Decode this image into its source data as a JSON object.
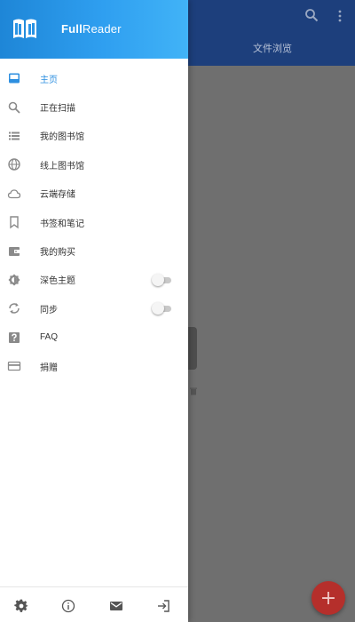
{
  "app": {
    "title_bold": "Full",
    "title_rest": "Reader"
  },
  "background": {
    "tab_label": "文件浏览"
  },
  "menu": {
    "items": [
      {
        "label": "主页",
        "icon": "inbox-icon",
        "active": true
      },
      {
        "label": "正在扫描",
        "icon": "search-icon"
      },
      {
        "label": "我的图书馆",
        "icon": "list-icon"
      },
      {
        "label": "线上图书馆",
        "icon": "globe-icon"
      },
      {
        "label": "云端存储",
        "icon": "cloud-icon"
      },
      {
        "label": "书签和笔记",
        "icon": "bookmark-icon"
      },
      {
        "label": "我的购买",
        "icon": "wallet-icon"
      },
      {
        "label": "深色主题",
        "icon": "brightness-icon",
        "toggle": false
      },
      {
        "label": "同步",
        "icon": "sync-icon",
        "toggle": false
      },
      {
        "label": "FAQ",
        "icon": "help-icon"
      },
      {
        "label": "捐赠",
        "icon": "credit-card-icon"
      }
    ]
  },
  "footer": {
    "icons": [
      "settings-icon",
      "info-icon",
      "mail-icon",
      "exit-icon"
    ]
  },
  "colors": {
    "accent": "#2d8fe0",
    "header_start": "#1e86d7",
    "header_end": "#41b3f7",
    "toolbar": "#1d3f7c",
    "fab": "#b52f2b"
  }
}
